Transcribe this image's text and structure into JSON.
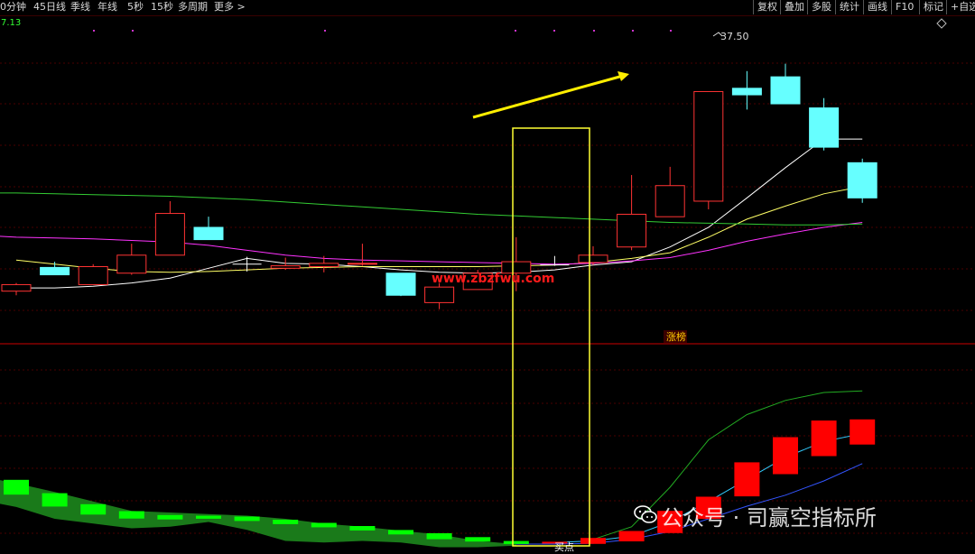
{
  "toolbar": {
    "left_items": [
      "0分钟",
      "45日线",
      "季线",
      "年线",
      "5秒",
      "15秒",
      "多周期",
      "更多 >"
    ],
    "right_items": [
      "复权",
      "叠加",
      "多股",
      "统计",
      "画线",
      "F10",
      "标记",
      "+自选"
    ],
    "diamond_icon": "diamond-outline-icon"
  },
  "chart_data": [
    {
      "type": "candlestick",
      "panel": "price",
      "top_label": "7.13",
      "high_annotation": "37.50",
      "ylim": [
        4.5,
        42
      ],
      "candles": [
        {
          "o": 10.6,
          "h": 11.6,
          "l": 10.1,
          "c": 11.4,
          "color": "red"
        },
        {
          "o": 13.5,
          "h": 14.2,
          "l": 12.9,
          "c": 12.6,
          "color": "cyan"
        },
        {
          "o": 11.4,
          "h": 13.9,
          "l": 11.4,
          "c": 13.6,
          "color": "red"
        },
        {
          "o": 12.8,
          "h": 16.4,
          "l": 12.6,
          "c": 15.0,
          "color": "red"
        },
        {
          "o": 15.0,
          "h": 21.6,
          "l": 15.0,
          "c": 20.1,
          "color": "red"
        },
        {
          "o": 18.4,
          "h": 19.7,
          "l": 16.9,
          "c": 16.9,
          "color": "cyan"
        },
        {
          "o": 13.9,
          "h": 14.8,
          "l": 13.0,
          "c": 13.9,
          "color": "white"
        },
        {
          "o": 13.4,
          "h": 14.7,
          "l": 13.2,
          "c": 13.7,
          "color": "red"
        },
        {
          "o": 13.6,
          "h": 14.9,
          "l": 12.9,
          "c": 14.0,
          "color": "red"
        },
        {
          "o": 13.9,
          "h": 16.4,
          "l": 13.7,
          "c": 14.0,
          "color": "red"
        },
        {
          "o": 12.8,
          "h": 12.8,
          "l": 10.0,
          "c": 10.1,
          "color": "cyan"
        },
        {
          "o": 9.2,
          "h": 11.6,
          "l": 8.4,
          "c": 11.1,
          "color": "red"
        },
        {
          "o": 10.8,
          "h": 13.2,
          "l": 10.8,
          "c": 12.8,
          "color": "red"
        },
        {
          "o": 12.8,
          "h": 17.2,
          "l": 10.6,
          "c": 14.2,
          "color": "red"
        },
        {
          "o": 13.7,
          "h": 14.9,
          "l": 13.7,
          "c": 13.8,
          "color": "white"
        },
        {
          "o": 14.1,
          "h": 16.1,
          "l": 13.8,
          "c": 15.0,
          "color": "red"
        },
        {
          "o": 16.0,
          "h": 24.8,
          "l": 15.6,
          "c": 20.0,
          "color": "red"
        },
        {
          "o": 19.7,
          "h": 25.8,
          "l": 19.7,
          "c": 23.5,
          "color": "red"
        },
        {
          "o": 21.6,
          "h": 35.0,
          "l": 20.6,
          "c": 35.0,
          "color": "red"
        },
        {
          "o": 35.4,
          "h": 37.5,
          "l": 32.8,
          "c": 34.6,
          "color": "cyan"
        },
        {
          "o": 36.8,
          "h": 38.4,
          "l": 33.5,
          "c": 33.5,
          "color": "cyan"
        },
        {
          "o": 33.0,
          "h": 34.2,
          "l": 27.8,
          "c": 28.2,
          "color": "cyan"
        },
        {
          "o": 26.3,
          "h": 26.8,
          "l": 21.4,
          "c": 22.0,
          "color": "cyan"
        }
      ],
      "ma_lines": [
        {
          "color": "#ffffff",
          "values": [
            11.0,
            11.0,
            11.2,
            11.6,
            12.2,
            13.4,
            14.6,
            14.0,
            13.9,
            13.6,
            13.2,
            12.9,
            12.8,
            12.9,
            13.2,
            13.8,
            14.2,
            16.0,
            18.4,
            22.0,
            25.7,
            29.2,
            29.2
          ]
        },
        {
          "color": "#ffff66",
          "values": [
            14.4,
            13.9,
            13.4,
            13.0,
            12.9,
            13.0,
            13.2,
            13.4,
            13.5,
            13.6,
            13.6,
            13.6,
            13.6,
            13.7,
            13.8,
            14.1,
            14.6,
            15.3,
            17.2,
            19.4,
            21.0,
            22.5,
            23.4
          ]
        },
        {
          "color": "#ff33ff",
          "values": [
            17.2,
            17.1,
            17.0,
            16.8,
            16.6,
            16.2,
            15.6,
            15.0,
            14.6,
            14.4,
            14.3,
            14.2,
            14.1,
            14.0,
            13.9,
            14.0,
            14.3,
            14.7,
            15.6,
            16.7,
            17.6,
            18.4,
            19.0
          ]
        },
        {
          "color": "#33cc33",
          "values": [
            22.6,
            22.5,
            22.4,
            22.3,
            22.2,
            22.0,
            21.8,
            21.5,
            21.2,
            20.9,
            20.6,
            20.3,
            20.0,
            19.8,
            19.6,
            19.4,
            19.2,
            19.0,
            18.9,
            18.8,
            18.7,
            18.7,
            18.8
          ]
        }
      ]
    },
    {
      "type": "bar",
      "panel": "indicator",
      "ylim": [
        0,
        240
      ],
      "bars": [
        {
          "value": 80,
          "color": "#00ff00",
          "thickness": 20
        },
        {
          "value": 64,
          "color": "#00ff00",
          "thickness": 18
        },
        {
          "value": 52,
          "color": "#00ff00",
          "thickness": 14
        },
        {
          "value": 45,
          "color": "#00ff00",
          "thickness": 10
        },
        {
          "value": 42,
          "color": "#00ff00",
          "thickness": 6
        },
        {
          "value": 42,
          "color": "#00ff00",
          "thickness": 4
        },
        {
          "value": 40,
          "color": "#00ff00",
          "thickness": 6
        },
        {
          "value": 36,
          "color": "#00ff00",
          "thickness": 6
        },
        {
          "value": 32,
          "color": "#00ff00",
          "thickness": 6
        },
        {
          "value": 28,
          "color": "#00ff00",
          "thickness": 6
        },
        {
          "value": 23,
          "color": "#00ff00",
          "thickness": 6
        },
        {
          "value": 18,
          "color": "#00ff00",
          "thickness": 8
        },
        {
          "value": 14,
          "color": "#00ff00",
          "thickness": 6
        },
        {
          "value": 10,
          "color": "#00ff00",
          "thickness": 4
        },
        {
          "value": 10,
          "color": "#ff0000",
          "thickness": 2
        },
        {
          "value": 12,
          "color": "#ff0000",
          "thickness": 8
        },
        {
          "value": 18,
          "color": "#ff0000",
          "thickness": 14
        },
        {
          "value": 36,
          "color": "#ff0000",
          "thickness": 30
        },
        {
          "value": 54,
          "color": "#ff0000",
          "thickness": 30
        },
        {
          "value": 90,
          "color": "#ff0000",
          "thickness": 46
        },
        {
          "value": 120,
          "color": "#ff0000",
          "thickness": 50
        },
        {
          "value": 142,
          "color": "#ff0000",
          "thickness": 48
        },
        {
          "value": 150,
          "color": "#ff0000",
          "thickness": 34
        }
      ],
      "green_area_top": [
        85,
        74,
        62,
        50,
        48,
        46,
        44,
        40,
        34,
        30,
        25,
        20,
        12,
        8
      ],
      "green_area_bottom": [
        55,
        40,
        34,
        28,
        30,
        36,
        26,
        12,
        10,
        12,
        10,
        4,
        4,
        6
      ],
      "line_blue": [
        null,
        null,
        null,
        null,
        null,
        null,
        null,
        null,
        null,
        null,
        null,
        null,
        null,
        8,
        8,
        9,
        14,
        24,
        40,
        56,
        70,
        88,
        110
      ],
      "line_cyan": [
        null,
        null,
        null,
        null,
        null,
        null,
        null,
        null,
        null,
        null,
        null,
        null,
        null,
        null,
        10,
        12,
        18,
        36,
        62,
        90,
        118,
        138,
        148
      ],
      "line_green": [
        null,
        null,
        null,
        null,
        null,
        null,
        null,
        null,
        null,
        null,
        null,
        null,
        null,
        null,
        null,
        14,
        30,
        80,
        140,
        172,
        190,
        200,
        202
      ]
    }
  ],
  "annotations": {
    "watermark_url": "www.zbzfwu.com",
    "zhangting_label": "涨榜",
    "buy_label": "买点",
    "brand_watermark": "公众号 · 司赢空指标所",
    "colors": {
      "bg": "#000000",
      "grid": "#5a0000",
      "highlight_box": "#ffff33",
      "arrow": "#ffee00",
      "up": "#ff3333",
      "down": "#66ffff"
    }
  }
}
